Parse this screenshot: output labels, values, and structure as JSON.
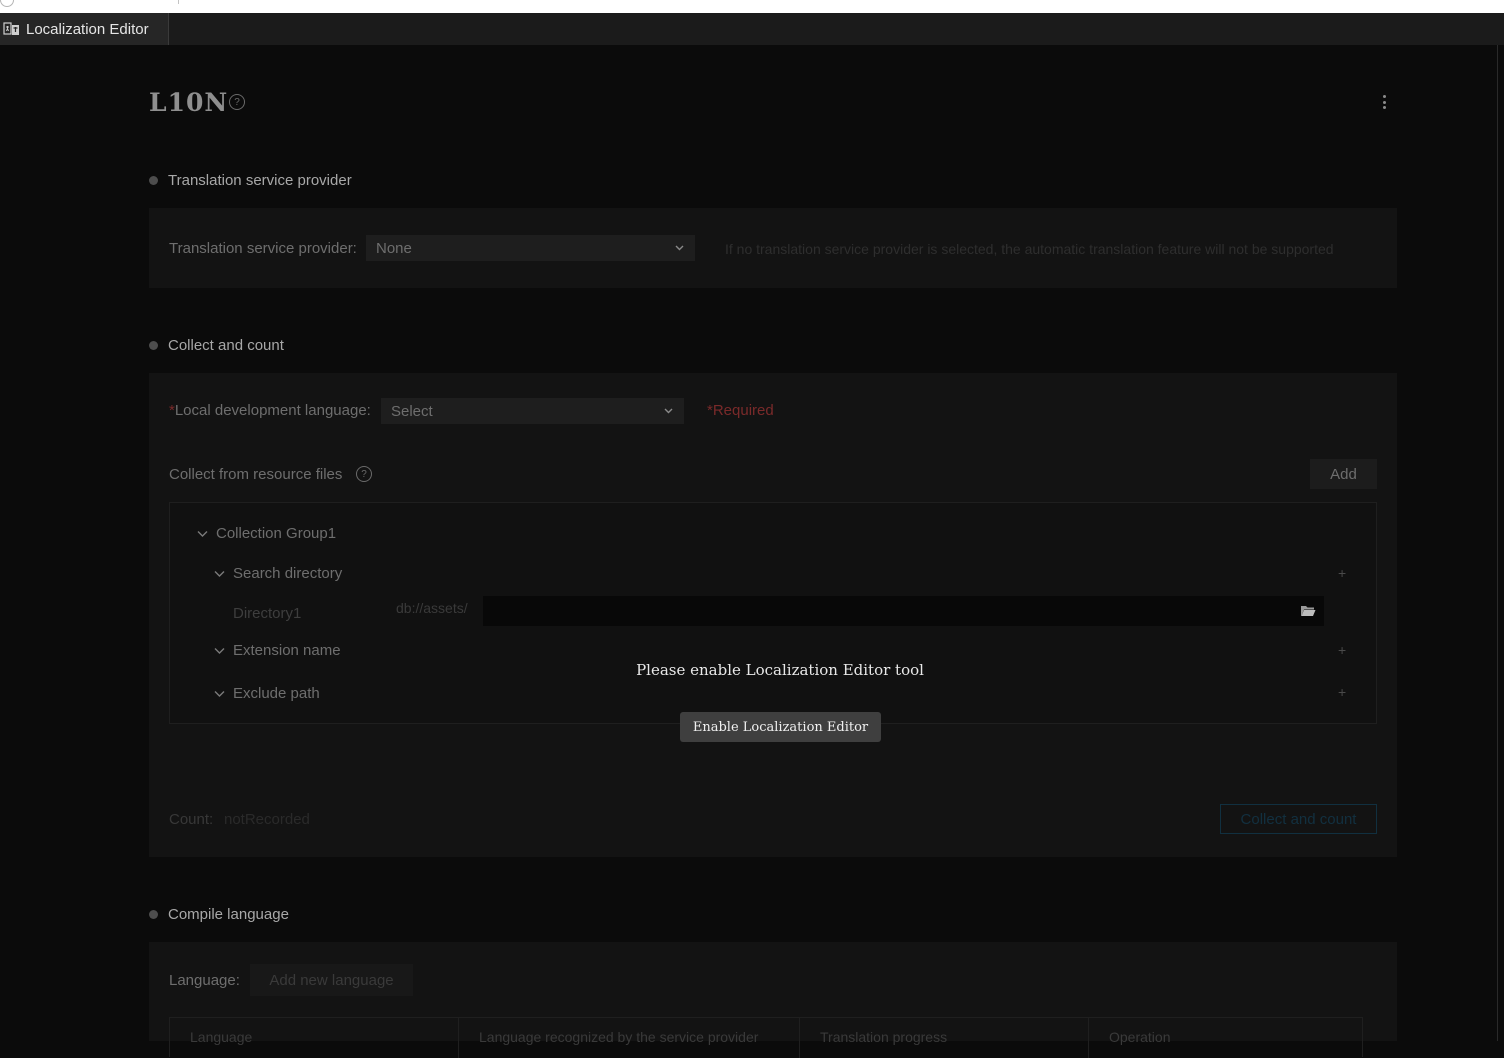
{
  "window": {
    "tab_label": "Localization Editor"
  },
  "header": {
    "title": "L10N"
  },
  "translation_section": {
    "heading": "Translation service provider",
    "field_label": "Translation service provider:",
    "selected_value": "None",
    "hint": "If no translation service provider is selected, the automatic translation feature will not be supported"
  },
  "collect_section": {
    "heading": "Collect and count",
    "local_language_star": "*",
    "local_language_label": "Local development language:",
    "local_language_value": "Select",
    "required_text": "*Required",
    "resource_files_label": "Collect from resource files",
    "add_label": "Add",
    "tree": {
      "group_label": "Collection Group1",
      "search_directory_label": "Search directory",
      "directory_label": "Directory1",
      "directory_prefix": "db://assets/",
      "directory_value": "",
      "extension_label": "Extension name",
      "exclude_label": "Exclude path",
      "plus_symbol": "+"
    },
    "count_label": "Count:",
    "count_value": "notRecorded",
    "collect_button_label": "Collect and count"
  },
  "overlay": {
    "message": "Please enable Localization Editor tool",
    "button_label": "Enable Localization Editor"
  },
  "compile_section": {
    "heading": "Compile language",
    "language_label": "Language:",
    "add_language_label": "Add new language",
    "table_headers": [
      "Language",
      "Language recognized by the service provider",
      "Translation progress",
      "Operation"
    ]
  },
  "colors": {
    "background": "#0b0b0b",
    "card": "#131313",
    "required": "#7a2a2a",
    "overlay_button": "#3f3f3f"
  },
  "icons": {
    "tab": "localization-icon",
    "help": "question-circle-icon",
    "menu": "kebab-menu-icon",
    "dropdown": "chevron-down-icon",
    "expand": "caret-down-icon",
    "folder": "folder-open-icon"
  }
}
